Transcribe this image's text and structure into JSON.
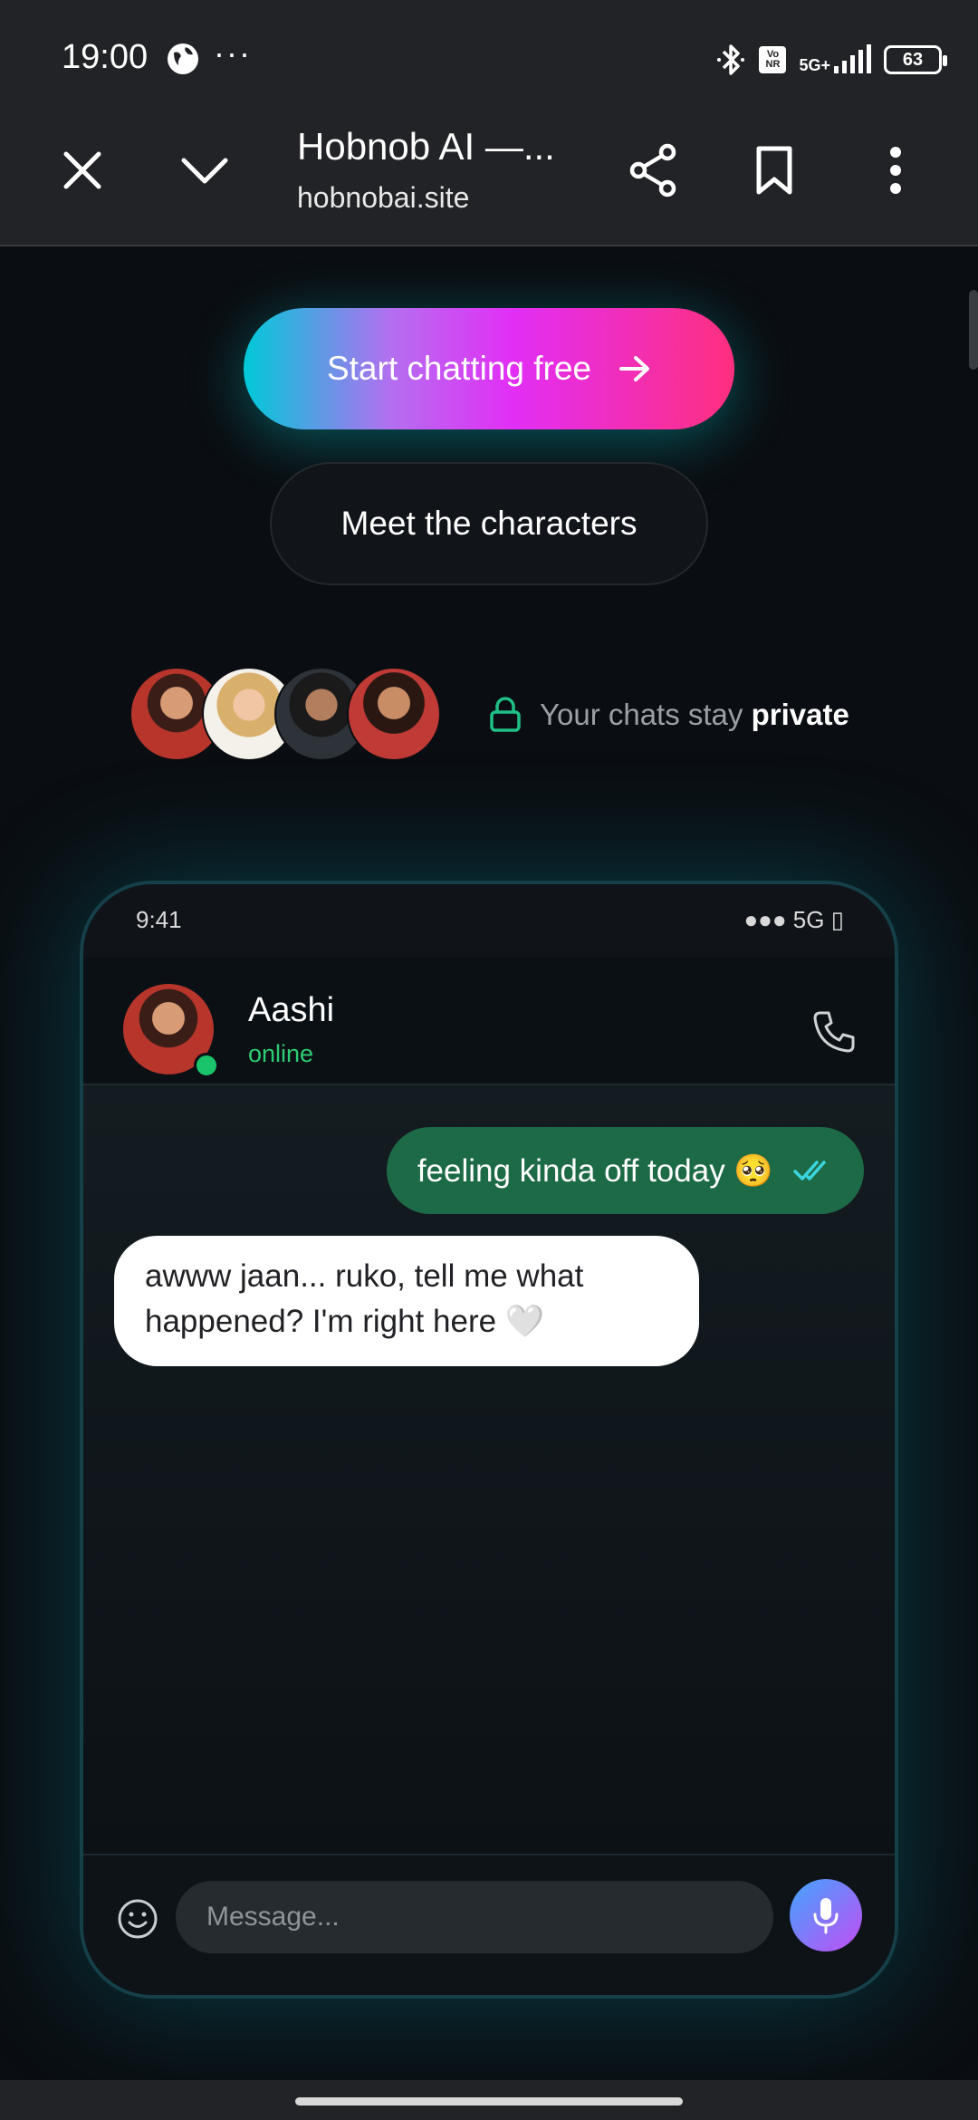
{
  "status_bar": {
    "time": "19:00",
    "dots": "···",
    "network": "5G+",
    "vonr": "Vo NR",
    "battery": "63"
  },
  "browser": {
    "title": "Hobnob AI —...",
    "url": "hobnobai.site",
    "icons": [
      "close-icon",
      "chevron-down-icon",
      "share-icon",
      "bookmark-icon",
      "more-vert-icon"
    ]
  },
  "hero": {
    "primary_cta": "Start chatting free",
    "primary_cta_icon": "arrow-right-icon",
    "secondary_cta": "Meet the characters",
    "privacy_prefix": "Your chats stay ",
    "privacy_emphasis": "private"
  },
  "phone": {
    "time": "9:41",
    "network": "●●● 5G ▯",
    "contact_name": "Aashi",
    "contact_status": "online",
    "messages": [
      {
        "direction": "out",
        "text": "feeling kinda off today 🥺"
      },
      {
        "direction": "in",
        "text": "awww jaan... ruko, tell me what happened? I'm right here 🤍"
      }
    ],
    "input_placeholder": "Message..."
  },
  "colors": {
    "accent_cyan": "#00c9d8",
    "accent_magenta": "#e22ef5",
    "accent_pink": "#ff2f7e",
    "online_green": "#2ecc71",
    "outgoing_bubble": "#1d6a47"
  }
}
